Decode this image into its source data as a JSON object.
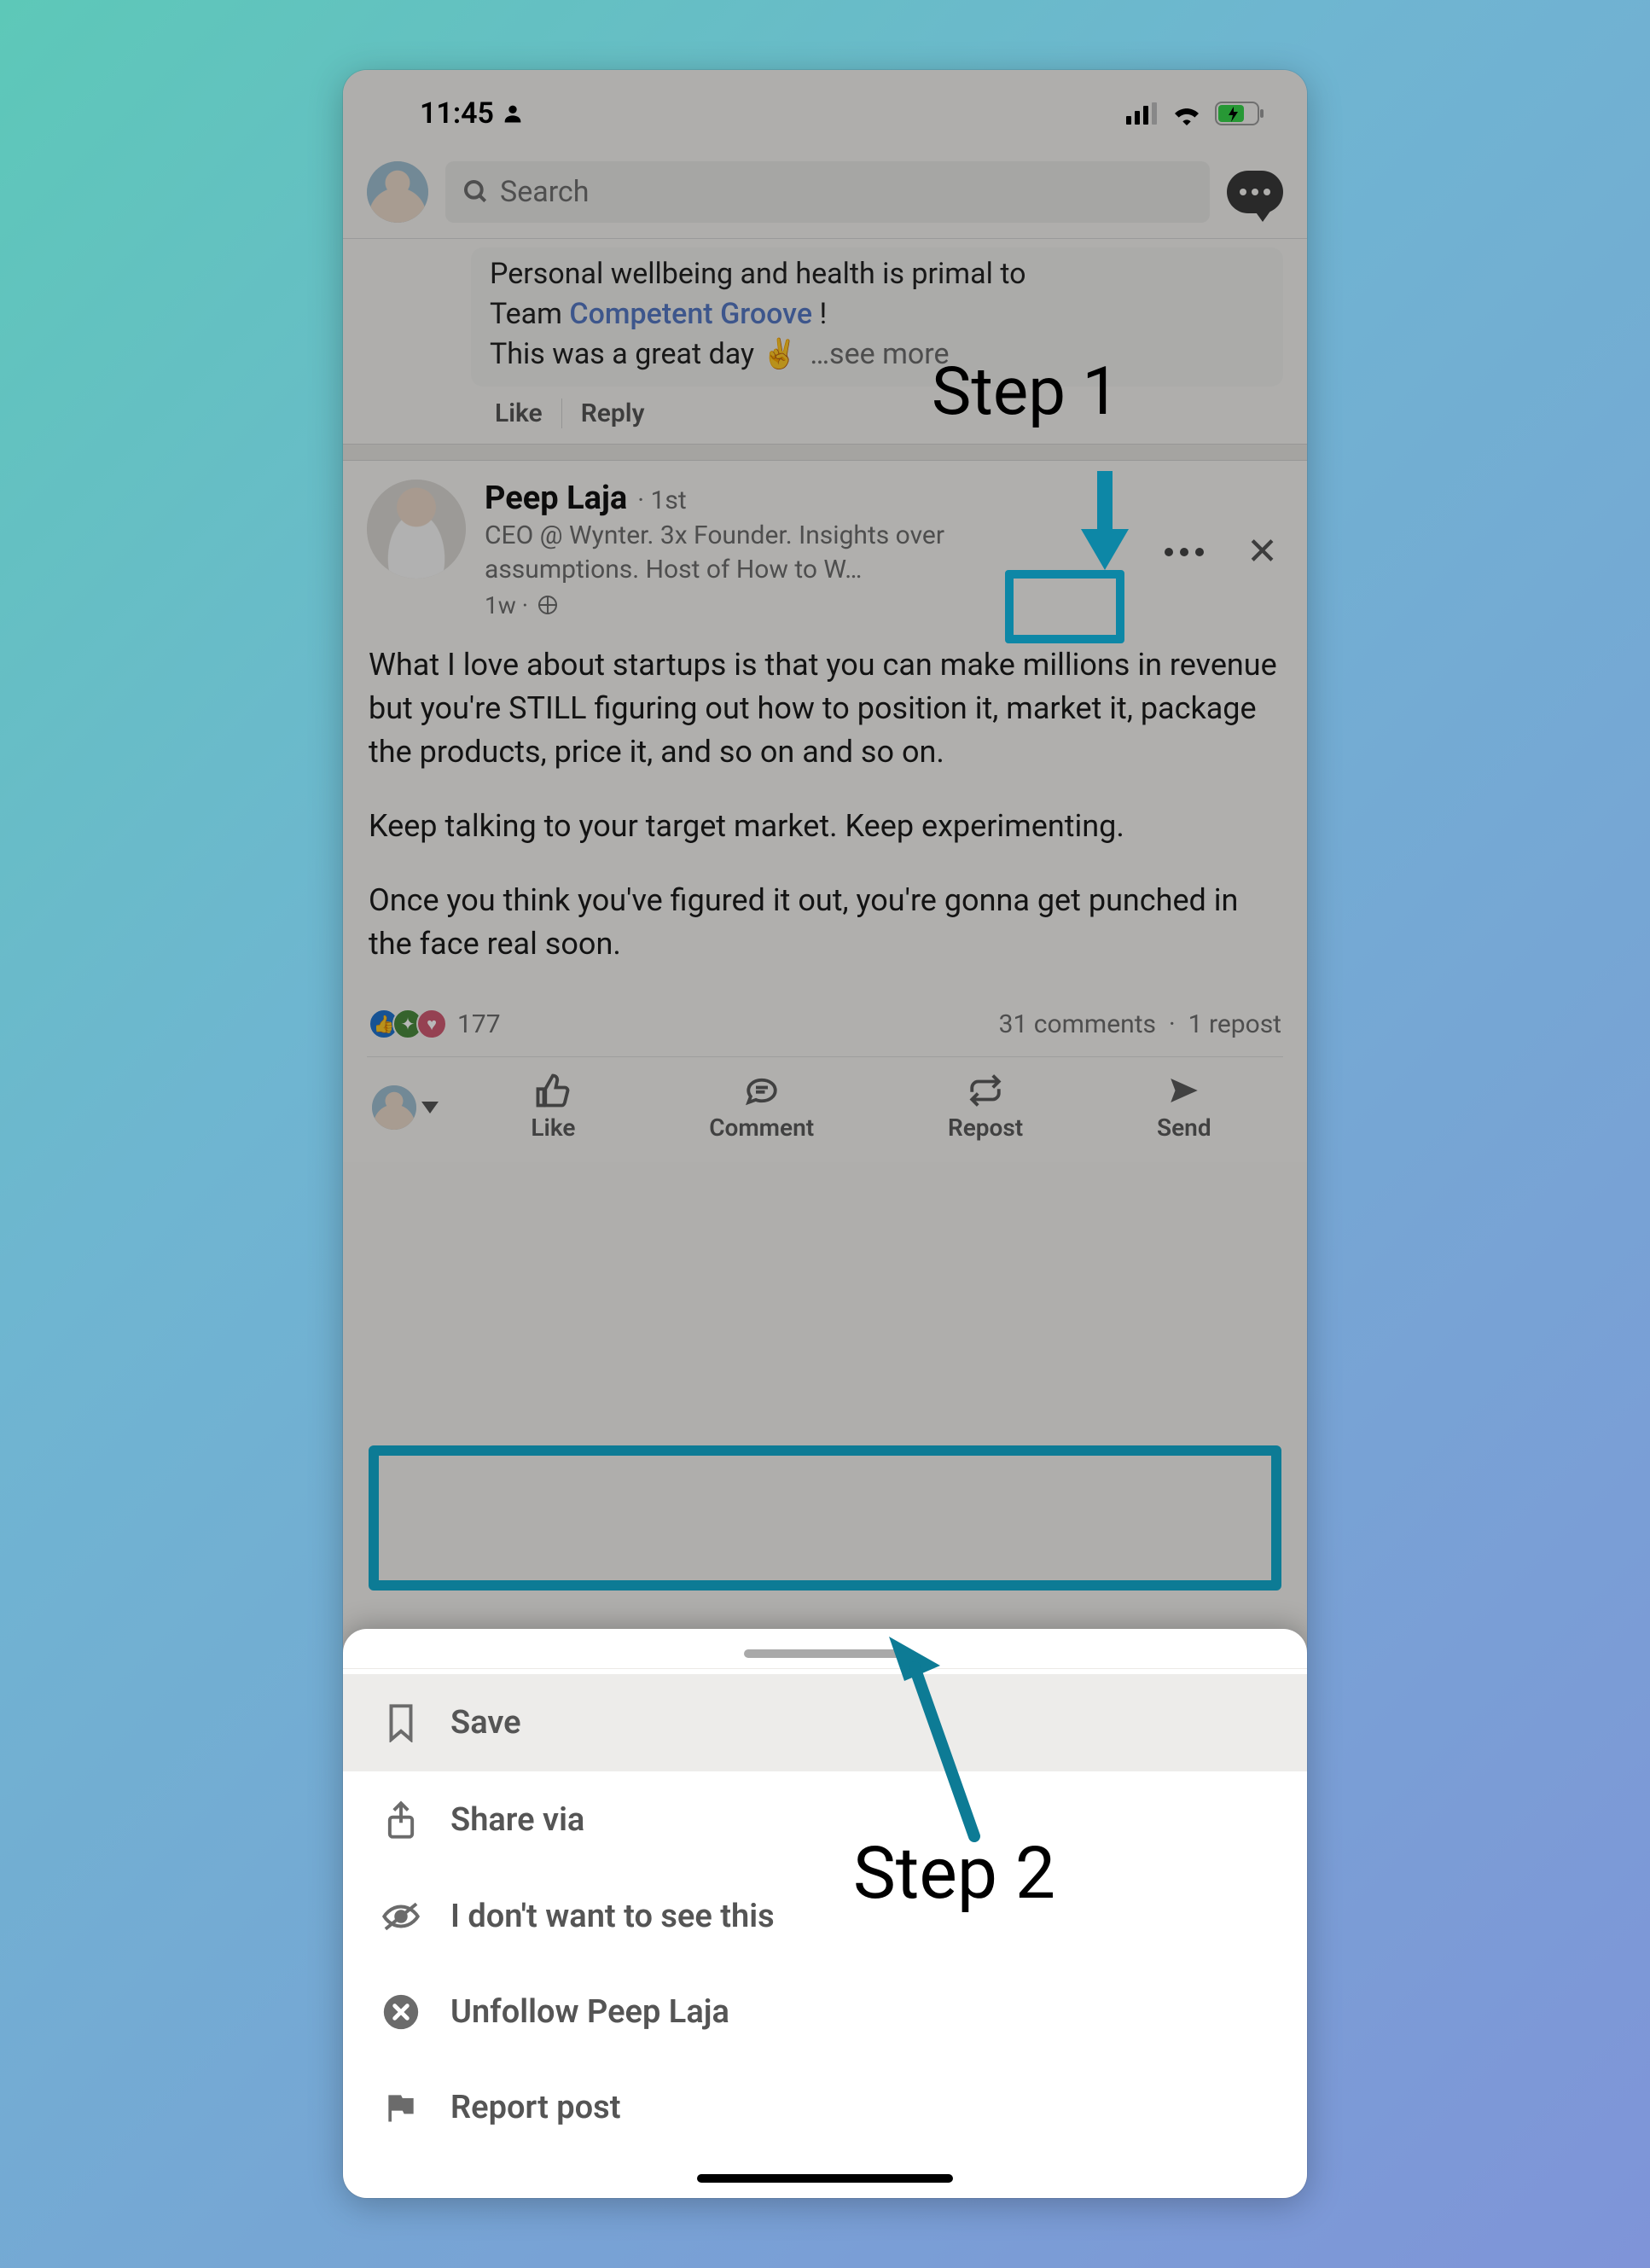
{
  "status_bar": {
    "time": "11:45"
  },
  "header": {
    "search_placeholder": "Search"
  },
  "top_comment": {
    "line1": "Personal wellbeing and health is primal to",
    "line2_prefix": "Team ",
    "mention": "Competent Groove",
    "line2_suffix": " !",
    "line3": "This was a great day ✌️",
    "see_more": "…see more",
    "actions": {
      "like": "Like",
      "reply": "Reply"
    }
  },
  "post": {
    "author_name": "Peep Laja",
    "connection": "· 1st",
    "subtitle": "CEO @ Wynter. 3x Founder. Insights over assumptions. Host of How to W…",
    "time": "1w ·",
    "body_p1": "What I love about startups is that you can make millions in revenue but you're STILL figuring out how to position it, market it, package the products, price it, and so on and so on.",
    "body_p2": "Keep talking to your target market. Keep experimenting.",
    "body_p3": "Once you think you've figured it out, you're gonna get punched in the face real soon.",
    "react_count": "177",
    "comments": "31 comments",
    "reposts": "1 repost",
    "action_like": "Like",
    "action_comment": "Comment",
    "action_repost": "Repost",
    "action_send": "Send"
  },
  "sheet": {
    "save": "Save",
    "share": "Share via",
    "dontsee": "I don't want to see this",
    "unfollow": "Unfollow Peep Laja",
    "report": "Report post"
  },
  "annotations": {
    "step1": "Step 1",
    "step2": "Step 2"
  }
}
